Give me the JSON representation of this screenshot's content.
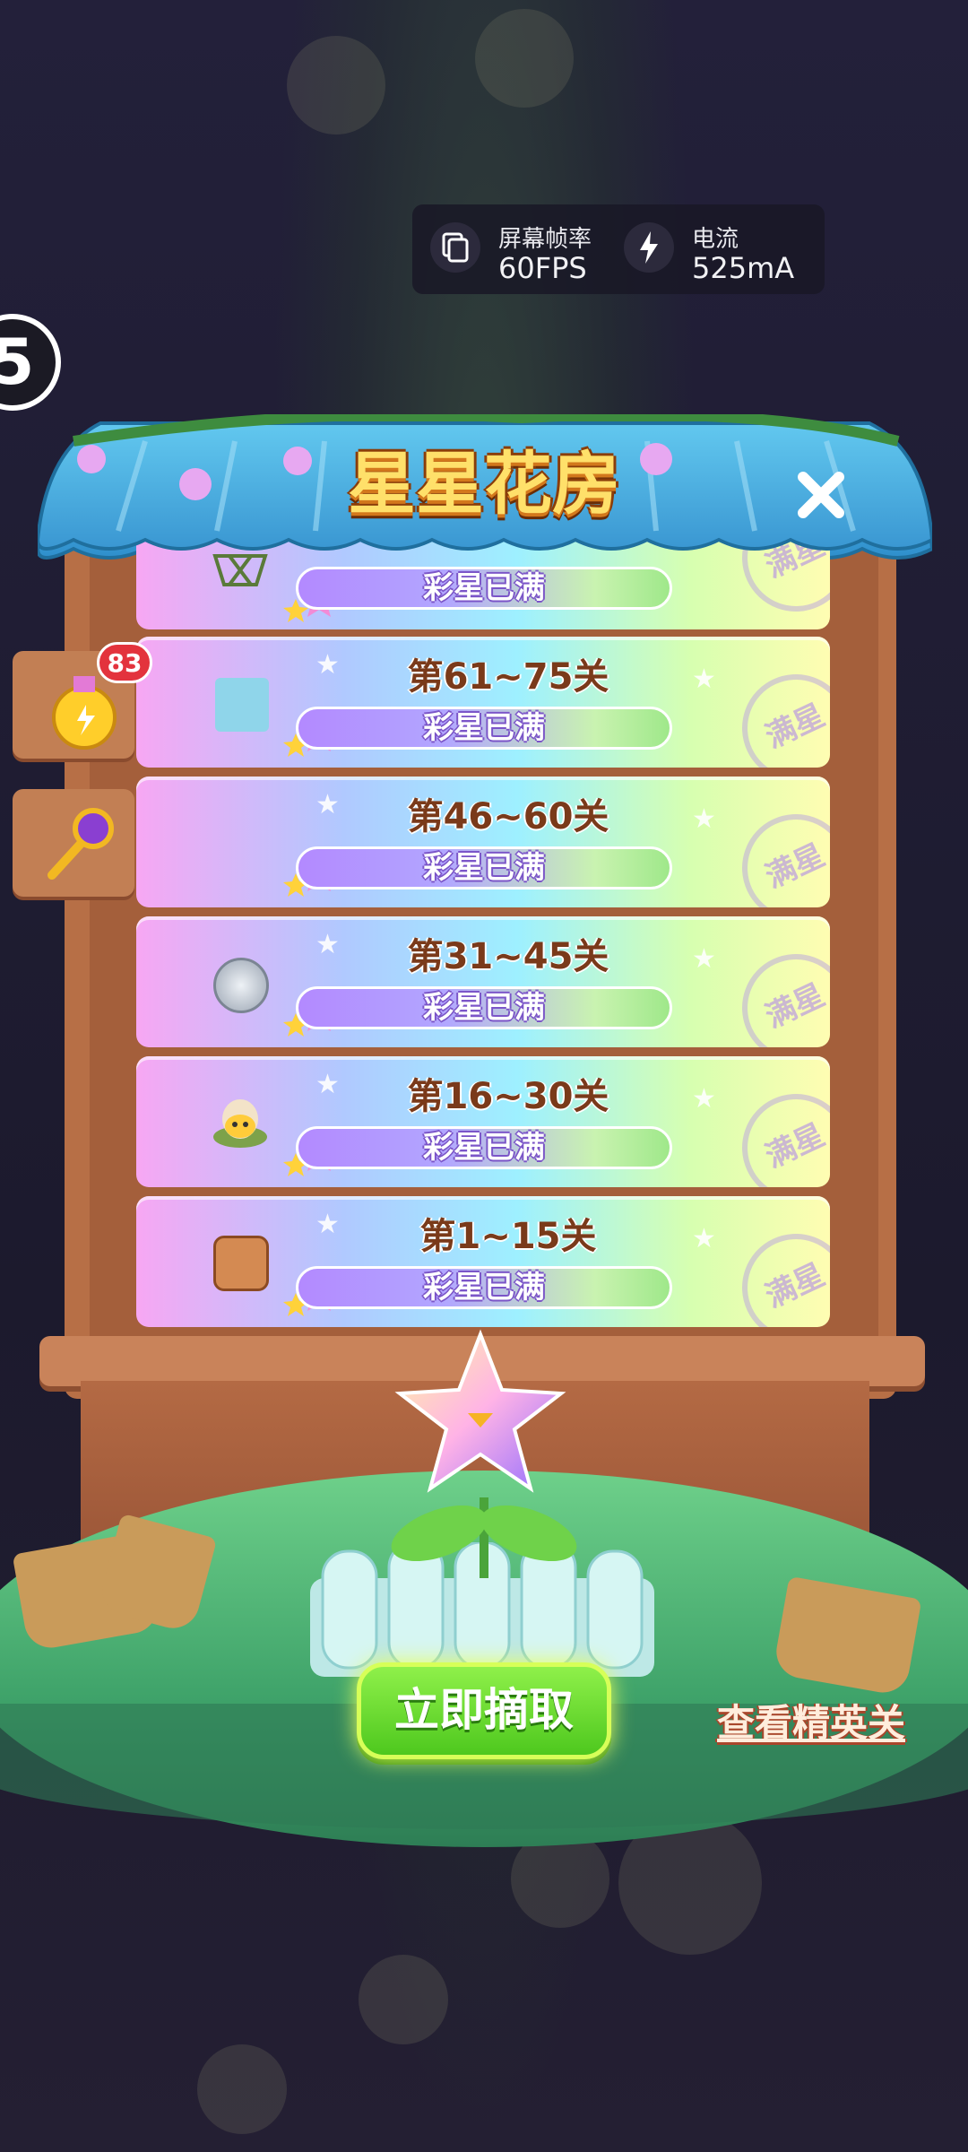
{
  "overlay": {
    "fps_label": "屏幕帧率",
    "fps_value": "60FPS",
    "current_label": "电流",
    "current_value": "525mA"
  },
  "level_indicator": "5",
  "panel": {
    "title": "星星花房",
    "rows": [
      {
        "title": "",
        "status": "彩星已满",
        "stamp": "满星",
        "icon": "net-icon"
      },
      {
        "title": "第61~75关",
        "status": "彩星已满",
        "stamp": "满星",
        "icon": "ice-block-icon"
      },
      {
        "title": "第46~60关",
        "status": "彩星已满",
        "stamp": "满星",
        "icon": ""
      },
      {
        "title": "第31~45关",
        "status": "彩星已满",
        "stamp": "满星",
        "icon": "silver-coin-icon"
      },
      {
        "title": "第16~30关",
        "status": "彩星已满",
        "stamp": "满星",
        "icon": "hatching-chick-icon"
      },
      {
        "title": "第1~15关",
        "status": "彩星已满",
        "stamp": "满星",
        "icon": "cookie-bear-icon"
      }
    ]
  },
  "side": {
    "potion_count": "83"
  },
  "actions": {
    "harvest": "立即摘取",
    "view_elite": "查看精英关"
  }
}
